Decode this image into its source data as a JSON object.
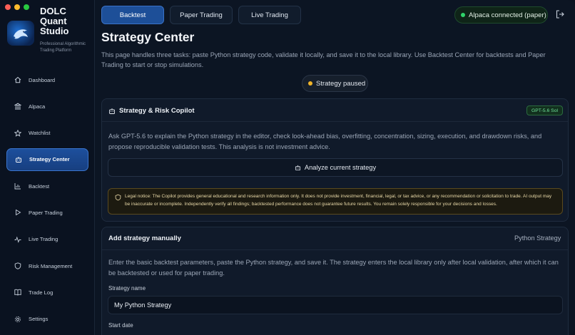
{
  "app": {
    "title": "DOLC Quant Studio",
    "subtitle": "Professional Algorithmic Trading Platform"
  },
  "sidebar": {
    "items": [
      {
        "label": "Dashboard",
        "icon": "home-icon"
      },
      {
        "label": "Alpaca",
        "icon": "bank-icon"
      },
      {
        "label": "Watchlist",
        "icon": "star-icon"
      },
      {
        "label": "Strategy Center",
        "icon": "robot-icon",
        "active": true
      },
      {
        "label": "Backtest",
        "icon": "chart-icon"
      },
      {
        "label": "Paper Trading",
        "icon": "play-icon"
      },
      {
        "label": "Live Trading",
        "icon": "pulse-icon"
      },
      {
        "label": "Risk Management",
        "icon": "shield-icon"
      },
      {
        "label": "Trade Log",
        "icon": "book-icon"
      },
      {
        "label": "Settings",
        "icon": "gear-icon"
      }
    ]
  },
  "tabs": [
    {
      "label": "Backtest",
      "active": true
    },
    {
      "label": "Paper Trading"
    },
    {
      "label": "Live Trading"
    }
  ],
  "connection": {
    "label": "Alpaca connected (paper)",
    "color": "#2fd46b"
  },
  "page": {
    "title": "Strategy Center",
    "description": "This page handles three tasks: paste Python strategy code, validate it locally, and save it to the local library. Use Backtest Center for backtests and Paper Trading to start or stop simulations."
  },
  "status": {
    "label": "Strategy paused",
    "color": "#f0b429"
  },
  "copilot": {
    "title": "Strategy & Risk Copilot",
    "badge": "GPT-5.6 Sol",
    "description": "Ask GPT-5.6 to explain the Python strategy in the editor, check look-ahead bias, overfitting, concentration, sizing, execution, and drawdown risks, and propose reproducible validation tests. This analysis is not investment advice.",
    "button_label": "Analyze current strategy",
    "legal_notice": "Legal notice: The Copilot provides general educational and research information only. It does not provide investment, financial, legal, or tax advice, or any recommendation or solicitation to trade. AI output may be inaccurate or incomplete. Independently verify all findings; backtested performance does not guarantee future results. You remain solely responsible for your decisions and losses."
  },
  "manual": {
    "title": "Add strategy manually",
    "type_label": "Python Strategy",
    "description": "Enter the basic backtest parameters, paste the Python strategy, and save it. The strategy enters the local library only after local validation, after which it can be backtested or used for paper trading.",
    "name_label": "Strategy name",
    "name_value": "My Python Strategy",
    "start_label": "Start date"
  }
}
